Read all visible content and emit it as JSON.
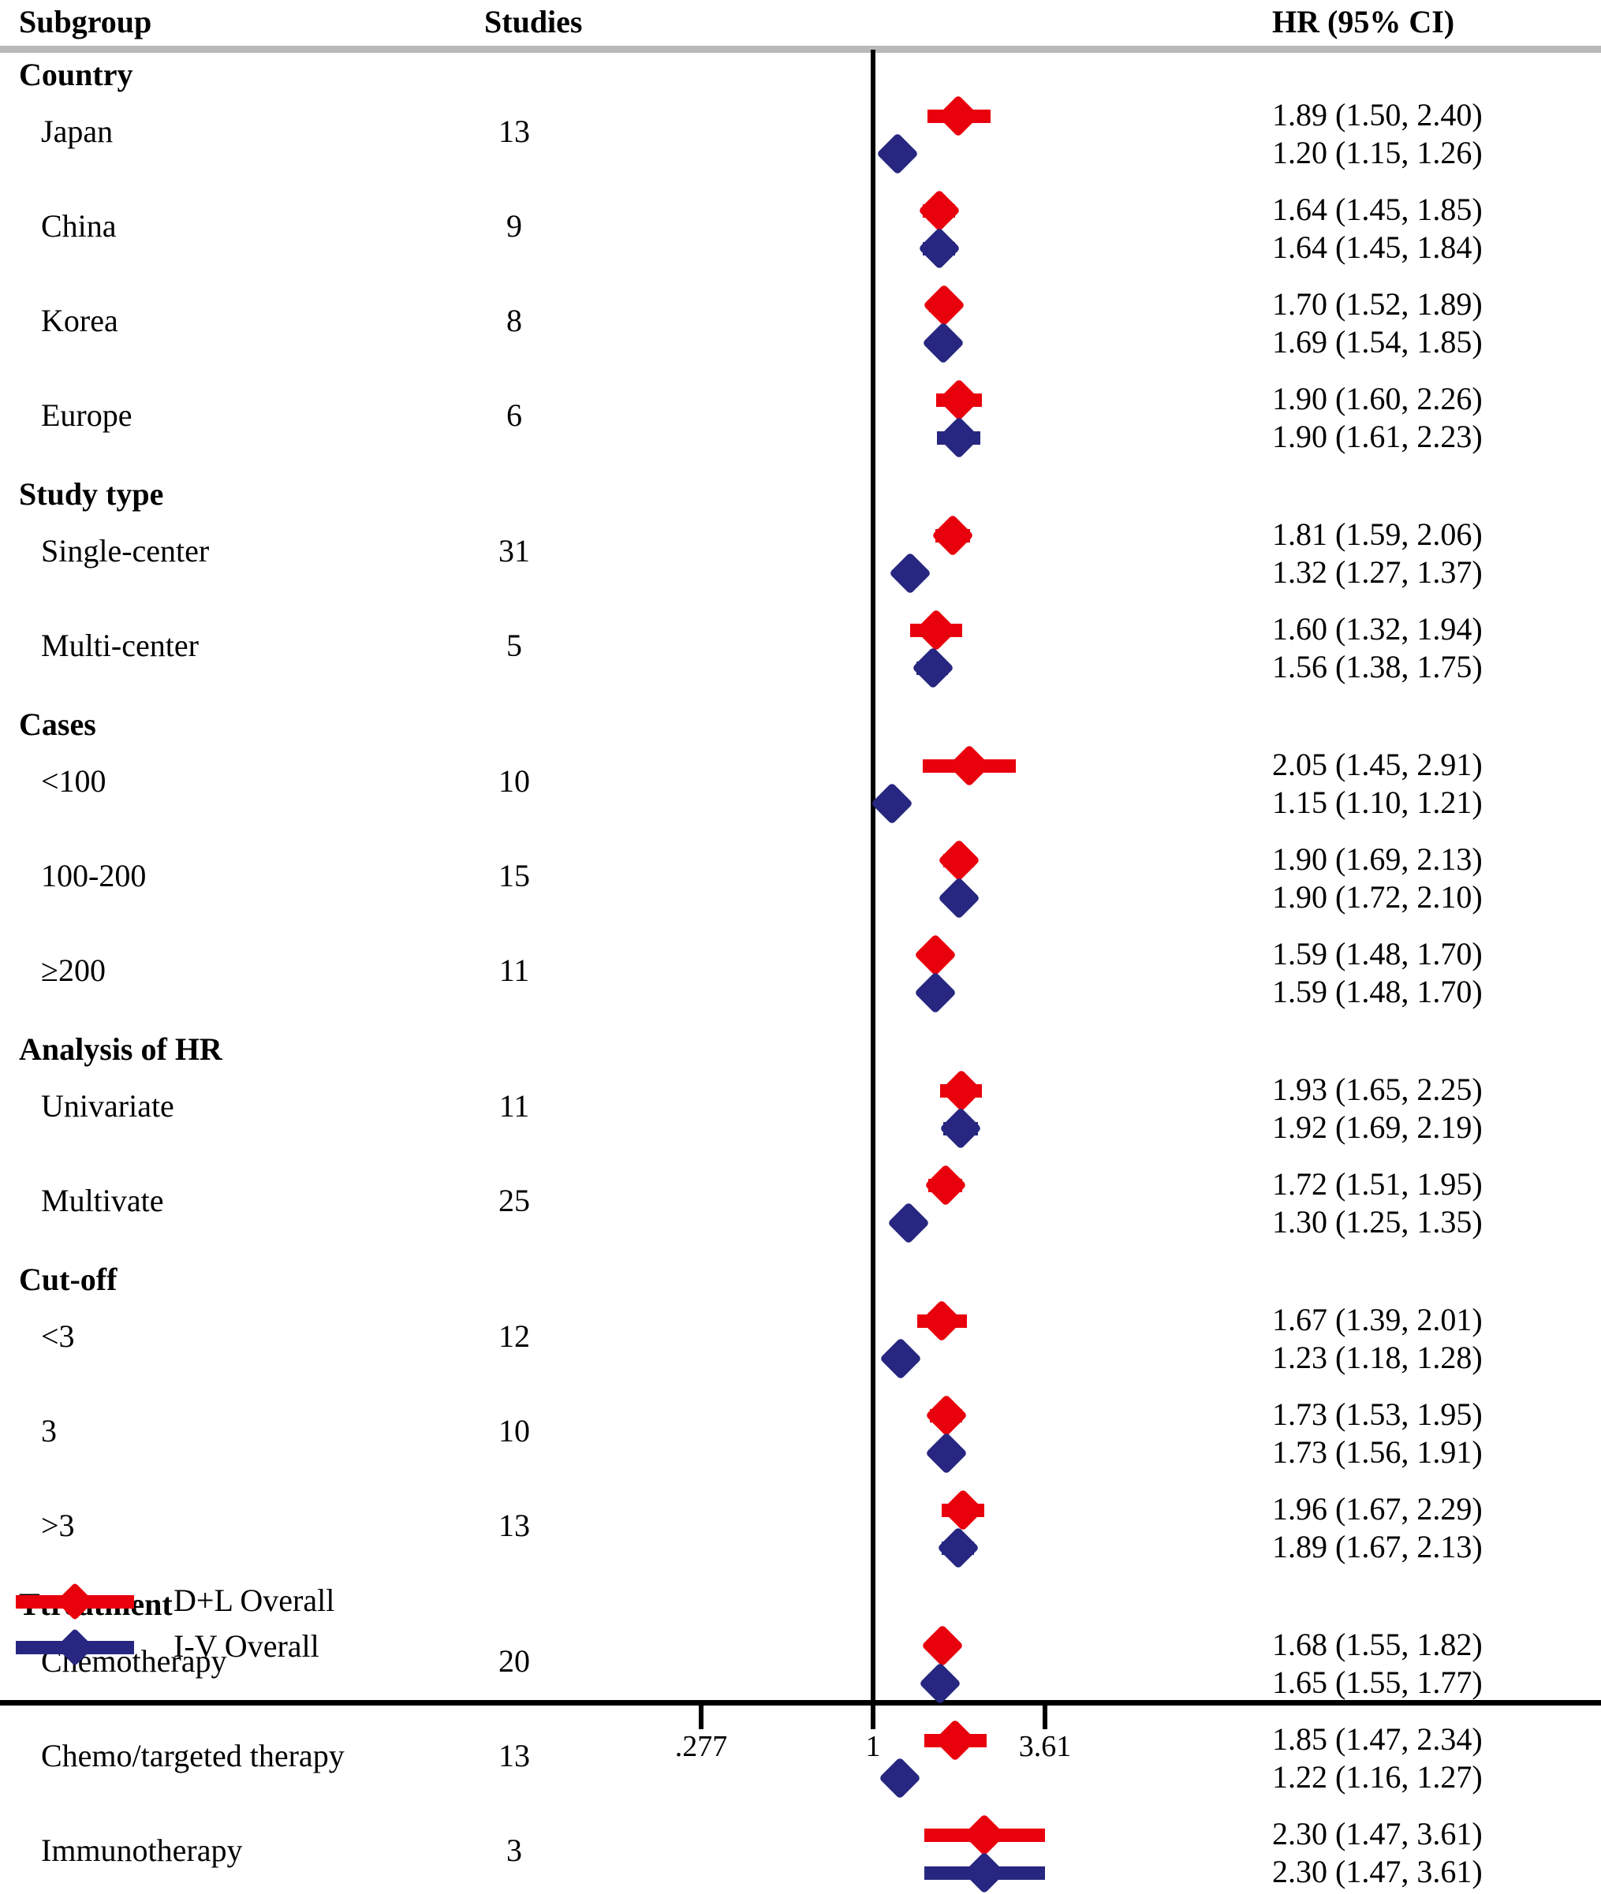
{
  "header": {
    "subgroup": "Subgroup",
    "studies": "Studies",
    "hr": "HR (95% CI)"
  },
  "legend": [
    {
      "label": "D+L Overall",
      "color": "#e8000d",
      "key": "dl"
    },
    {
      "label": "I-V Overall",
      "color": "#272781",
      "key": "iv"
    }
  ],
  "axis": {
    "ticks": [
      {
        "label": ".277",
        "value": 0.277
      },
      {
        "label": "1",
        "value": 1
      },
      {
        "label": "3.61",
        "value": 3.61
      }
    ],
    "reference_line": 1,
    "scale": "log"
  },
  "chart_data": {
    "type": "forest",
    "title": "",
    "xlabel": "",
    "ylabel": "",
    "xscale": "log",
    "xlim": [
      0.277,
      3.61
    ],
    "reference_line": 1,
    "series_colors": {
      "D+L Overall": "#e8000d",
      "I-V Overall": "#272781"
    },
    "groups": [
      {
        "name": "Country",
        "rows": [
          {
            "label": "Japan",
            "studies": "13",
            "dl": {
              "hr": 1.89,
              "lo": 1.5,
              "hi": 2.4,
              "text": "1.89 (1.50, 2.40)"
            },
            "iv": {
              "hr": 1.2,
              "lo": 1.15,
              "hi": 1.26,
              "text": "1.20 (1.15, 1.26)"
            }
          },
          {
            "label": "China",
            "studies": "9",
            "dl": {
              "hr": 1.64,
              "lo": 1.45,
              "hi": 1.85,
              "text": "1.64 (1.45, 1.85)"
            },
            "iv": {
              "hr": 1.64,
              "lo": 1.45,
              "hi": 1.84,
              "text": "1.64 (1.45, 1.84)"
            }
          },
          {
            "label": "Korea",
            "studies": "8",
            "dl": {
              "hr": 1.7,
              "lo": 1.52,
              "hi": 1.89,
              "text": "1.70 (1.52, 1.89)"
            },
            "iv": {
              "hr": 1.69,
              "lo": 1.54,
              "hi": 1.85,
              "text": "1.69 (1.54, 1.85)"
            }
          },
          {
            "label": "Europe",
            "studies": "6",
            "dl": {
              "hr": 1.9,
              "lo": 1.6,
              "hi": 2.26,
              "text": "1.90 (1.60, 2.26)"
            },
            "iv": {
              "hr": 1.9,
              "lo": 1.61,
              "hi": 2.23,
              "text": "1.90 (1.61, 2.23)"
            }
          }
        ]
      },
      {
        "name": "Study type",
        "rows": [
          {
            "label": "Single-center",
            "studies": "31",
            "dl": {
              "hr": 1.81,
              "lo": 1.59,
              "hi": 2.06,
              "text": "1.81 (1.59, 2.06)"
            },
            "iv": {
              "hr": 1.32,
              "lo": 1.27,
              "hi": 1.37,
              "text": "1.32 (1.27, 1.37)"
            }
          },
          {
            "label": "Multi-center",
            "studies": "5",
            "dl": {
              "hr": 1.6,
              "lo": 1.32,
              "hi": 1.94,
              "text": "1.60 (1.32, 1.94)"
            },
            "iv": {
              "hr": 1.56,
              "lo": 1.38,
              "hi": 1.75,
              "text": "1.56 (1.38, 1.75)"
            }
          }
        ]
      },
      {
        "name": "Cases",
        "rows": [
          {
            "label": "<100",
            "studies": "10",
            "dl": {
              "hr": 2.05,
              "lo": 1.45,
              "hi": 2.91,
              "text": "2.05 (1.45, 2.91)"
            },
            "iv": {
              "hr": 1.15,
              "lo": 1.1,
              "hi": 1.21,
              "text": "1.15 (1.10, 1.21)"
            }
          },
          {
            "label": "100-200",
            "studies": "15",
            "dl": {
              "hr": 1.9,
              "lo": 1.69,
              "hi": 2.13,
              "text": "1.90 (1.69, 2.13)"
            },
            "iv": {
              "hr": 1.9,
              "lo": 1.72,
              "hi": 2.1,
              "text": "1.90 (1.72, 2.10)"
            }
          },
          {
            "label": "≥200",
            "studies": "11",
            "dl": {
              "hr": 1.59,
              "lo": 1.48,
              "hi": 1.7,
              "text": "1.59 (1.48, 1.70)"
            },
            "iv": {
              "hr": 1.59,
              "lo": 1.48,
              "hi": 1.7,
              "text": "1.59 (1.48, 1.70)"
            }
          }
        ]
      },
      {
        "name": "Analysis of HR",
        "rows": [
          {
            "label": "Univariate",
            "studies": "11",
            "dl": {
              "hr": 1.93,
              "lo": 1.65,
              "hi": 2.25,
              "text": "1.93 (1.65, 2.25)"
            },
            "iv": {
              "hr": 1.92,
              "lo": 1.69,
              "hi": 2.19,
              "text": "1.92 (1.69, 2.19)"
            }
          },
          {
            "label": "Multivate",
            "studies": "25",
            "dl": {
              "hr": 1.72,
              "lo": 1.51,
              "hi": 1.95,
              "text": "1.72 (1.51, 1.95)"
            },
            "iv": {
              "hr": 1.3,
              "lo": 1.25,
              "hi": 1.35,
              "text": "1.30 (1.25, 1.35)"
            }
          }
        ]
      },
      {
        "name": "Cut-off",
        "rows": [
          {
            "label": "<3",
            "studies": "12",
            "dl": {
              "hr": 1.67,
              "lo": 1.39,
              "hi": 2.01,
              "text": "1.67 (1.39, 2.01)"
            },
            "iv": {
              "hr": 1.23,
              "lo": 1.18,
              "hi": 1.28,
              "text": "1.23 (1.18, 1.28)"
            }
          },
          {
            "label": "3",
            "studies": "10",
            "dl": {
              "hr": 1.73,
              "lo": 1.53,
              "hi": 1.95,
              "text": "1.73 (1.53, 1.95)"
            },
            "iv": {
              "hr": 1.73,
              "lo": 1.56,
              "hi": 1.91,
              "text": "1.73 (1.56, 1.91)"
            }
          },
          {
            "label": ">3",
            "studies": "13",
            "dl": {
              "hr": 1.96,
              "lo": 1.67,
              "hi": 2.29,
              "text": "1.96 (1.67, 2.29)"
            },
            "iv": {
              "hr": 1.89,
              "lo": 1.67,
              "hi": 2.13,
              "text": "1.89 (1.67, 2.13)"
            }
          }
        ]
      },
      {
        "name": "Ttreatment",
        "rows": [
          {
            "label": "Chemotherapy",
            "studies": "20",
            "dl": {
              "hr": 1.68,
              "lo": 1.55,
              "hi": 1.82,
              "text": "1.68 (1.55, 1.82)"
            },
            "iv": {
              "hr": 1.65,
              "lo": 1.55,
              "hi": 1.77,
              "text": "1.65 (1.55, 1.77)"
            }
          },
          {
            "label": "Chemo/targeted therapy",
            "studies": "13",
            "dl": {
              "hr": 1.85,
              "lo": 1.47,
              "hi": 2.34,
              "text": "1.85 (1.47, 2.34)"
            },
            "iv": {
              "hr": 1.22,
              "lo": 1.16,
              "hi": 1.27,
              "text": "1.22 (1.16, 1.27)"
            }
          },
          {
            "label": "Immunotherapy",
            "studies": "3",
            "dl": {
              "hr": 2.3,
              "lo": 1.47,
              "hi": 3.61,
              "text": "2.30 (1.47, 3.61)"
            },
            "iv": {
              "hr": 2.3,
              "lo": 1.47,
              "hi": 3.61,
              "text": "2.30 (1.47, 3.61)"
            }
          }
        ]
      }
    ]
  }
}
